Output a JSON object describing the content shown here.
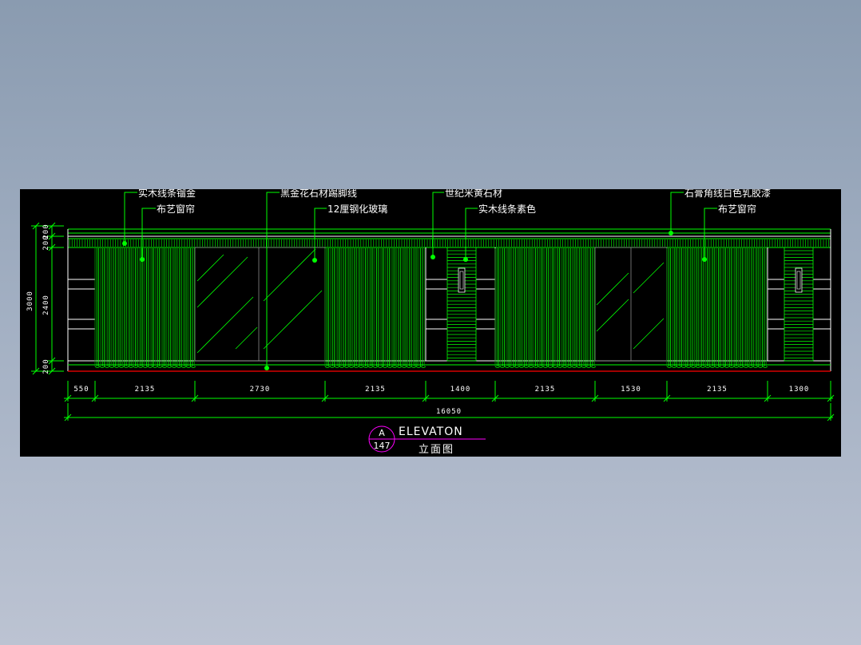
{
  "colors": {
    "background_top": "#8a9bb0",
    "sheet": "#000000",
    "line_green": "#00ff00",
    "dark_green": "#00a000",
    "white": "#ffffff",
    "red": "#ff0000",
    "magenta": "#ff00ff",
    "gray": "#8a8a8a"
  },
  "annotations": [
    "实木线条镏金",
    "布艺窗帘",
    "黑金花石材踢脚线",
    "12厘钢化玻璃",
    "世纪米黄石材",
    "实木线条素色",
    "石膏角线白色乳胶漆",
    "布艺窗帘"
  ],
  "dimensions": {
    "horizontal": [
      "550",
      "2135",
      "2730",
      "2135",
      "1400",
      "2135",
      "1530",
      "2135",
      "1300"
    ],
    "total": "16050",
    "vertical_outer": "3000",
    "vertical_inner": [
      "200",
      "200",
      "2400",
      "200"
    ]
  },
  "title_block": {
    "letter": "A",
    "number": "147",
    "title": "ELEVATON",
    "subtitle": "立面图"
  }
}
